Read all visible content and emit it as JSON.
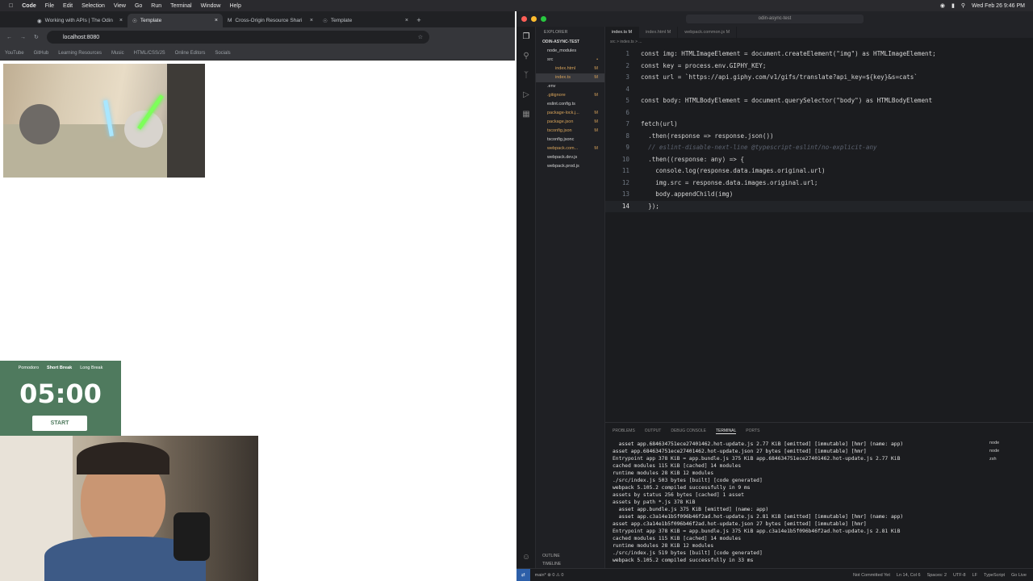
{
  "menubar": {
    "apple_icon": "apple-icon",
    "items": [
      "Code",
      "File",
      "Edit",
      "Selection",
      "View",
      "Go",
      "Run",
      "Terminal",
      "Window",
      "Help"
    ],
    "datetime": "Wed Feb 26 9:46 PM"
  },
  "browser": {
    "tabs": [
      {
        "label": "Working with APIs | The Odin"
      },
      {
        "label": "Template"
      },
      {
        "label": "Cross-Origin Resource Shari"
      },
      {
        "label": "Template"
      }
    ],
    "new_tab": "+",
    "url": "localhost:8080",
    "bookmarks": [
      "YouTube",
      "GitHub",
      "Learning Resources",
      "Music",
      "HTML/CSS/JS",
      "Online Editors",
      "Socials"
    ]
  },
  "timer": {
    "modes": [
      "Pomodoro",
      "Short Break",
      "Long Break"
    ],
    "time": "05:00",
    "start_label": "START"
  },
  "vscode": {
    "search": "odin-async-test",
    "explorer_header": "EXPLORER",
    "project": "ODIN-ASYNC-TEST",
    "files": [
      {
        "name": "node_modules",
        "indent": 0,
        "status": ""
      },
      {
        "name": "src",
        "indent": 0,
        "status": "•"
      },
      {
        "name": "index.html",
        "indent": 1,
        "status": "M"
      },
      {
        "name": "index.ts",
        "indent": 1,
        "status": "M"
      },
      {
        "name": ".env",
        "indent": 0,
        "status": ""
      },
      {
        "name": ".gitignore",
        "indent": 0,
        "status": "M"
      },
      {
        "name": "eslint.config.ts",
        "indent": 0,
        "status": ""
      },
      {
        "name": "package-lock.j...",
        "indent": 0,
        "status": "M"
      },
      {
        "name": "package.json",
        "indent": 0,
        "status": "M"
      },
      {
        "name": "tsconfig.json",
        "indent": 0,
        "status": "M"
      },
      {
        "name": "tsconfig.jsonc",
        "indent": 0,
        "status": ""
      },
      {
        "name": "webpack.com...",
        "indent": 0,
        "status": "M"
      },
      {
        "name": "webpack.dev.js",
        "indent": 0,
        "status": ""
      },
      {
        "name": "webpack.prod.js",
        "indent": 0,
        "status": ""
      }
    ],
    "outline": "OUTLINE",
    "timeline": "TIMELINE",
    "editor_tabs": [
      "index.ts M",
      "index.html M",
      "webpack.common.js M"
    ],
    "breadcrumb": "src > index.ts > ...",
    "code": [
      "const img: HTMLImageElement = document.createElement(\"img\") as HTMLImageElement;",
      "const key = process.env.GIPHY_KEY;",
      "const url = `https://api.giphy.com/v1/gifs/translate?api_key=${key}&s=cats`",
      "",
      "const body: HTMLBodyElement = document.querySelector(\"body\") as HTMLBodyElement",
      "",
      "fetch(url)",
      "  .then(response => response.json())",
      "  // eslint-disable-next-line @typescript-eslint/no-explicit-any",
      "  .then((response: any) => {",
      "    console.log(response.data.images.original.url)",
      "    img.src = response.data.images.original.url;",
      "    body.appendChild(img)",
      "  });"
    ],
    "panel_tabs": [
      "PROBLEMS",
      "OUTPUT",
      "DEBUG CONSOLE",
      "TERMINAL",
      "PORTS"
    ],
    "terminal": [
      "  asset app.684634751ece27401462.hot-update.js 2.77 KiB [emitted] [immutable] [hmr] (name: app)",
      "asset app.684634751ece27401462.hot-update.json 27 bytes [emitted] [immutable] [hmr]",
      "Entrypoint app 378 KiB = app.bundle.js 375 KiB app.684634751ece27401462.hot-update.js 2.77 KiB",
      "cached modules 115 KiB [cached] 14 modules",
      "runtime modules 28 KiB 12 modules",
      "./src/index.js 503 bytes [built] [code generated]",
      "webpack 5.105.2 compiled successfully in 9 ms",
      "assets by status 256 bytes [cached] 1 asset",
      "assets by path *.js 378 KiB",
      "  asset app.bundle.js 375 KiB [emitted] (name: app)",
      "  asset app.c3a14e1b5f096b46f2ad.hot-update.js 2.81 KiB [emitted] [immutable] [hmr] (name: app)",
      "asset app.c3a14e1b5f096b46f2ad.hot-update.json 27 bytes [emitted] [immutable] [hmr]",
      "Entrypoint app 378 KiB = app.bundle.js 375 KiB app.c3a14e1b5f096b46f2ad.hot-update.js 2.81 KiB",
      "cached modules 115 KiB [cached] 14 modules",
      "runtime modules 28 KiB 12 modules",
      "./src/index.js 519 bytes [built] [code generated]",
      "webpack 5.105.2 compiled successfully in 33 ms",
      ""
    ],
    "sessions": [
      "node",
      "node",
      "zsh"
    ],
    "status_left": "main*  ⊗ 0 ⚠ 0",
    "status_right": [
      "Not Committed Yet",
      "Ln 14, Col 6",
      "Spaces: 2",
      "UTF-8",
      "LF",
      "TypeScript",
      "Go Live"
    ]
  },
  "colors": {
    "accent": "#4f7a5e",
    "editor_bg": "#1b1c1f",
    "keyword": "#5ba3e0",
    "string": "#d6a35a",
    "type": "#e2c16c"
  }
}
